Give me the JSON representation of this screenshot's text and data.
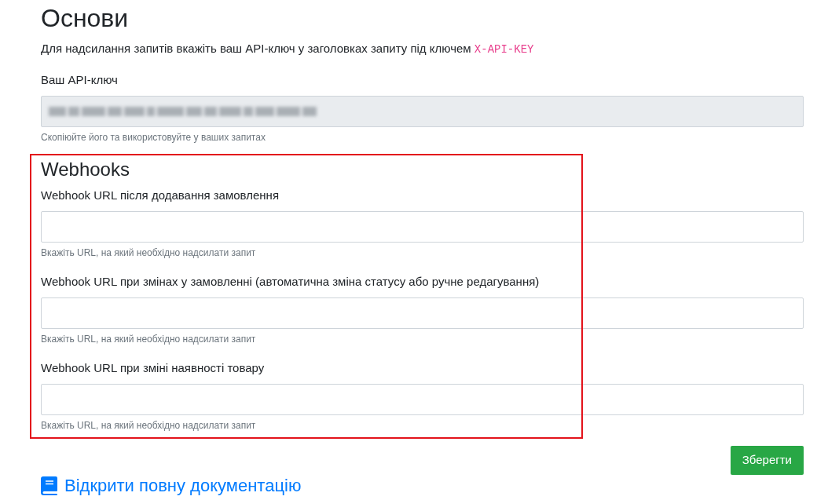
{
  "basics": {
    "title": "Основи",
    "intro": {
      "text": "Для надсилання запитів вкажіть ваш API-ключ у заголовках запиту під ключем",
      "code": "X-API-KEY"
    },
    "api_key": {
      "label": "Ваш API-ключ",
      "readonly": true,
      "obscured": true,
      "hint": "Скопіюйте його та використовуйте у ваших запитах"
    }
  },
  "webhooks": {
    "title": "Webhooks",
    "highlighted": true,
    "fields": [
      {
        "label": "Webhook URL після додавання замовлення",
        "hint": "Вкажіть URL, на який необхідно надсилати запит"
      },
      {
        "label": "Webhook URL при змінах у замовленні (автоматична зміна статусу або ручне редагування)",
        "hint": "Вкажіть URL, на який необхідно надсилати запит"
      },
      {
        "label": "Webhook URL при зміні наявності товару",
        "hint": "Вкажіть URL, на який необхідно надсилати запит"
      }
    ]
  },
  "save_button": "Зберегти",
  "docs_link": "Відкрити повну документацію"
}
